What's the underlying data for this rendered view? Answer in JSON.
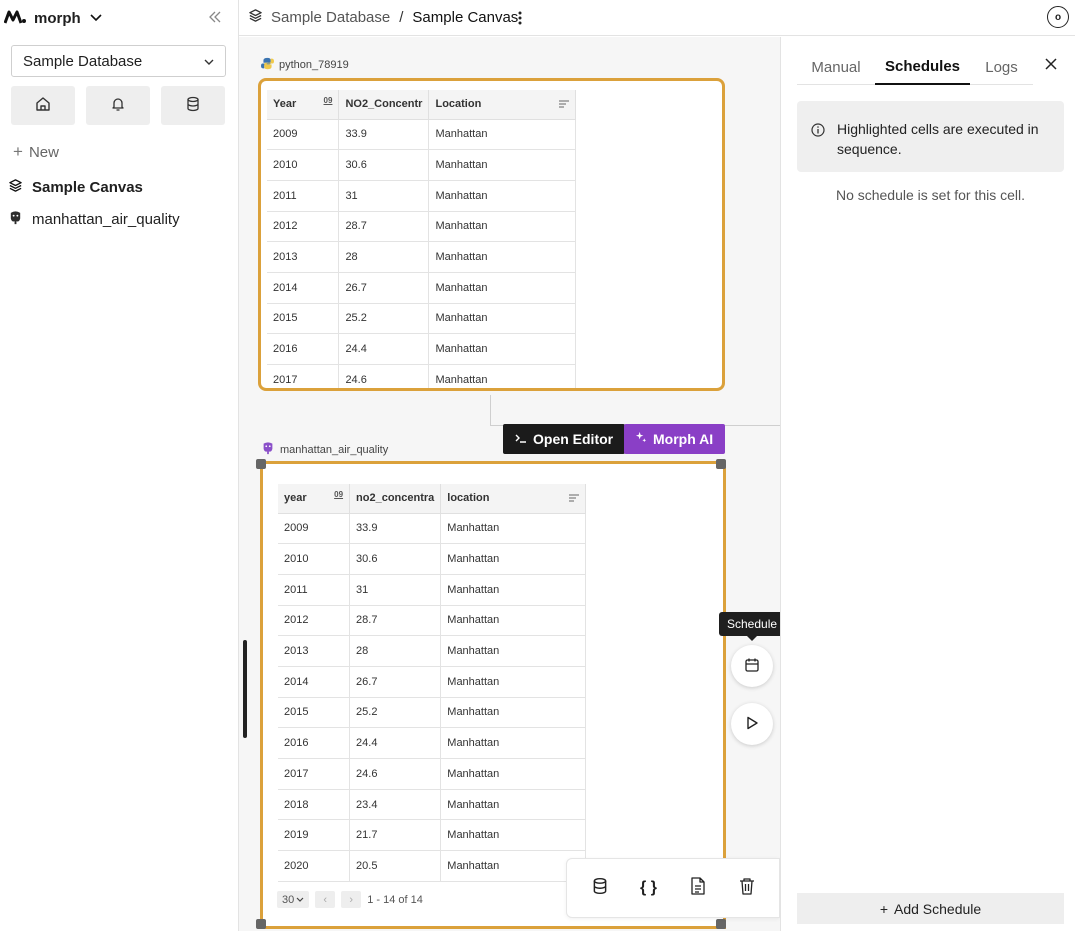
{
  "app": {
    "name": "morph"
  },
  "sidebar": {
    "database_select": "Sample Database",
    "new_label": "New",
    "items": [
      {
        "label": "Sample Canvas",
        "icon": "layers-icon"
      },
      {
        "label": "manhattan_air_quality",
        "icon": "postgres-icon"
      }
    ]
  },
  "topbar": {
    "breadcrumb_db": "Sample Database",
    "breadcrumb_sep": "/",
    "breadcrumb_canvas": "Sample Canvas",
    "avatar_letter": "o"
  },
  "cell1": {
    "name": "python_78919",
    "columns": [
      "Year",
      "NO2_Concentr",
      "Location"
    ],
    "type_tag": "09",
    "rows": [
      [
        "2009",
        "33.9",
        "Manhattan"
      ],
      [
        "2010",
        "30.6",
        "Manhattan"
      ],
      [
        "2011",
        "31",
        "Manhattan"
      ],
      [
        "2012",
        "28.7",
        "Manhattan"
      ],
      [
        "2013",
        "28",
        "Manhattan"
      ],
      [
        "2014",
        "26.7",
        "Manhattan"
      ],
      [
        "2015",
        "25.2",
        "Manhattan"
      ],
      [
        "2016",
        "24.4",
        "Manhattan"
      ],
      [
        "2017",
        "24.6",
        "Manhattan"
      ]
    ]
  },
  "actions": {
    "open_editor": "Open Editor",
    "morph_ai": "Morph AI"
  },
  "cell2": {
    "name": "manhattan_air_quality",
    "columns": [
      "year",
      "no2_concentra",
      "location"
    ],
    "type_tag": "09",
    "rows": [
      [
        "2009",
        "33.9",
        "Manhattan"
      ],
      [
        "2010",
        "30.6",
        "Manhattan"
      ],
      [
        "2011",
        "31",
        "Manhattan"
      ],
      [
        "2012",
        "28.7",
        "Manhattan"
      ],
      [
        "2013",
        "28",
        "Manhattan"
      ],
      [
        "2014",
        "26.7",
        "Manhattan"
      ],
      [
        "2015",
        "25.2",
        "Manhattan"
      ],
      [
        "2016",
        "24.4",
        "Manhattan"
      ],
      [
        "2017",
        "24.6",
        "Manhattan"
      ],
      [
        "2018",
        "23.4",
        "Manhattan"
      ],
      [
        "2019",
        "21.7",
        "Manhattan"
      ],
      [
        "2020",
        "20.5",
        "Manhattan"
      ]
    ],
    "page_size": "30",
    "page_info": "1 - 14 of 14"
  },
  "tooltip": "Schedule",
  "panel": {
    "tabs": [
      "Manual",
      "Schedules",
      "Logs"
    ],
    "active_tab": "Schedules",
    "info": "Highlighted cells are executed in sequence.",
    "empty": "No schedule is set for this cell.",
    "add_schedule": "Add Schedule"
  },
  "colors": {
    "highlight": "#dba13b",
    "ai_button": "#8a3fc6",
    "editor_button": "#1b1b1b"
  }
}
